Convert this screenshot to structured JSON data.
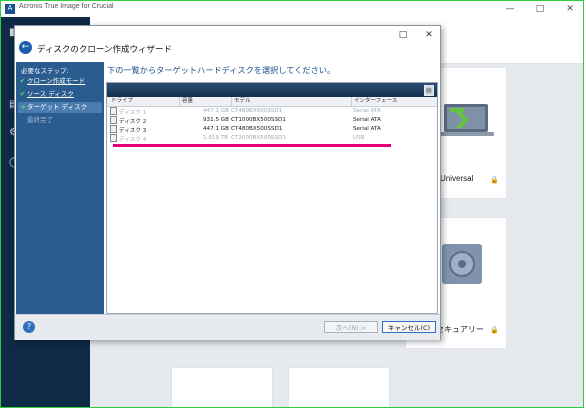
{
  "app": {
    "title": "Acronis True Image for Crucial",
    "logo_letter": "A",
    "controls": {
      "minimize": "—",
      "maximize": "□",
      "close": "✕"
    }
  },
  "tiles": {
    "universal_label": "Universal",
    "security_label": "セキュアリー"
  },
  "wizard": {
    "title": "ディスクのクローン作成ウィザード",
    "controls": {
      "maximize": "□",
      "close": "✕"
    },
    "steps_heading": "必要なステップ:",
    "steps": [
      {
        "label": "クローン作成モード",
        "state": "done"
      },
      {
        "label": "ソース ディスク",
        "state": "done"
      },
      {
        "label": "ターゲット ディスク",
        "state": "active"
      },
      {
        "label": "最終完了",
        "state": "pending"
      }
    ],
    "instruction": "下の一覧からターゲットハードディスクを選択してください。",
    "columns": [
      "ドライブ",
      "容量",
      "モデル",
      "インターフェース"
    ],
    "disks": [
      {
        "drive": "ディスク 1",
        "capacity": "447.1 GB",
        "model": "CT480BX500SSD1",
        "interface": "Serial ATA",
        "enabled": false
      },
      {
        "drive": "ディスク 2",
        "capacity": "931.5 GB",
        "model": "CT1000BX500SSD1",
        "interface": "Serial ATA",
        "enabled": true
      },
      {
        "drive": "ディスク 3",
        "capacity": "447.1 GB",
        "model": "CT480BX500SSD1",
        "interface": "Serial ATA",
        "enabled": true
      },
      {
        "drive": "ディスク 4",
        "capacity": "1.819 TB",
        "model": "CT2000BX500SSD1",
        "interface": "USB",
        "enabled": false
      }
    ],
    "buttons": {
      "next": "次へ(N) >",
      "cancel": "キャンセル(C)"
    },
    "help": "?"
  },
  "colors": {
    "sidebar": "#0e2a47",
    "steps_panel": "#2b5c8f",
    "highlight": "#e6007e"
  }
}
